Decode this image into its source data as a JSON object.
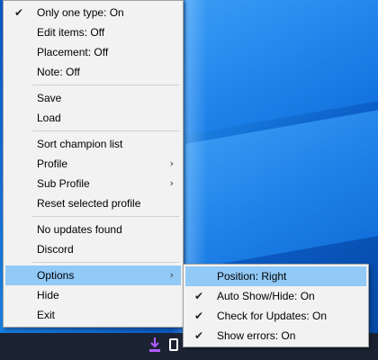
{
  "main_menu": {
    "items": [
      {
        "label": "Only one type: On",
        "checked": true
      },
      {
        "label": "Edit items: Off"
      },
      {
        "label": "Placement: Off"
      },
      {
        "label": "Note: Off"
      },
      {
        "label": "Save"
      },
      {
        "label": "Load"
      },
      {
        "label": "Sort champion list"
      },
      {
        "label": "Profile",
        "submenu": true
      },
      {
        "label": "Sub Profile",
        "submenu": true
      },
      {
        "label": "Reset selected profile"
      },
      {
        "label": "No updates found"
      },
      {
        "label": "Discord"
      },
      {
        "label": "Options",
        "submenu": true,
        "highlighted": true
      },
      {
        "label": "Hide"
      },
      {
        "label": "Exit"
      }
    ]
  },
  "options_submenu": {
    "items": [
      {
        "label": "Position: Right",
        "highlighted": true
      },
      {
        "label": "Auto Show/Hide: On",
        "checked": true
      },
      {
        "label": "Check for Updates: On",
        "checked": true
      },
      {
        "label": "Show errors: On",
        "checked": true
      }
    ]
  },
  "glyphs": {
    "check": "✔",
    "arrow": "›"
  },
  "colors": {
    "highlight": "#91c9f7",
    "menu_bg": "#f2f2f2",
    "taskbar": "#1b2333",
    "tray_icon": "#b15bff"
  }
}
